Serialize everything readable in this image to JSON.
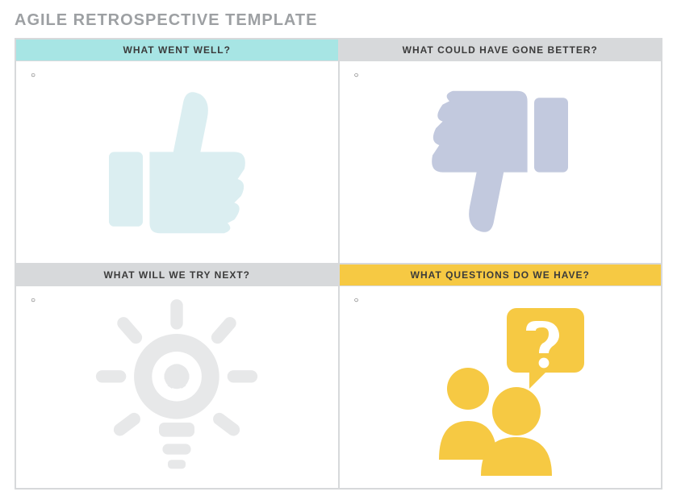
{
  "title": "AGILE RETROSPECTIVE TEMPLATE",
  "quadrants": {
    "q1": {
      "header": "WHAT WENT WELL?",
      "bullet": "○"
    },
    "q2": {
      "header": "WHAT COULD HAVE GONE BETTER?",
      "bullet": "○"
    },
    "q3": {
      "header": "WHAT WILL WE TRY NEXT?",
      "bullet": "○"
    },
    "q4": {
      "header": "WHAT QUESTIONS DO WE HAVE?",
      "bullet": "○"
    }
  },
  "colors": {
    "teal": "#a7e5e4",
    "gray": "#d7d9db",
    "yellow": "#f6c943",
    "thumbsUp": "#dbeef1",
    "thumbsDown": "#c2c9de",
    "bulb": "#e7e8e9",
    "question": "#f6c943"
  }
}
